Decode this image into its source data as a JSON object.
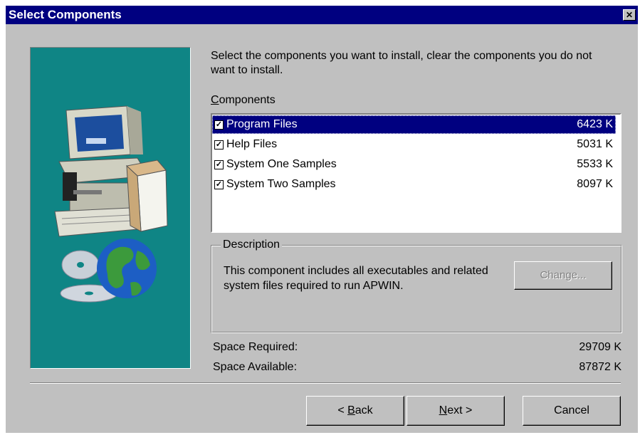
{
  "window": {
    "title": "Select Components"
  },
  "intro": "Select the components you want to install, clear the components you do not want to install.",
  "components": {
    "label": "Components",
    "items": [
      {
        "name": "Program Files",
        "size": "6423 K",
        "checked": true,
        "selected": true
      },
      {
        "name": "Help Files",
        "size": "5031 K",
        "checked": true,
        "selected": false
      },
      {
        "name": "System One Samples",
        "size": "5533 K",
        "checked": true,
        "selected": false
      },
      {
        "name": "System Two Samples",
        "size": "8097 K",
        "checked": true,
        "selected": false
      }
    ]
  },
  "description": {
    "legend": "Description",
    "text": "This component includes all executables and related system files required to run APWIN.",
    "change_label": "Change..."
  },
  "space": {
    "required_label": "Space Required:",
    "required_value": "29709 K",
    "available_label": "Space Available:",
    "available_value": "87872 K"
  },
  "buttons": {
    "back": "< Back",
    "next": "Next >",
    "cancel": "Cancel"
  },
  "colors": {
    "titlebar": "#000080",
    "face": "#c0c0c0",
    "banner": "#0f8585",
    "selection": "#000080"
  },
  "icons": [
    "close-icon",
    "computer-illustration",
    "cd-disc-illustration",
    "globe-illustration",
    "checkbox-checked-icon"
  ]
}
